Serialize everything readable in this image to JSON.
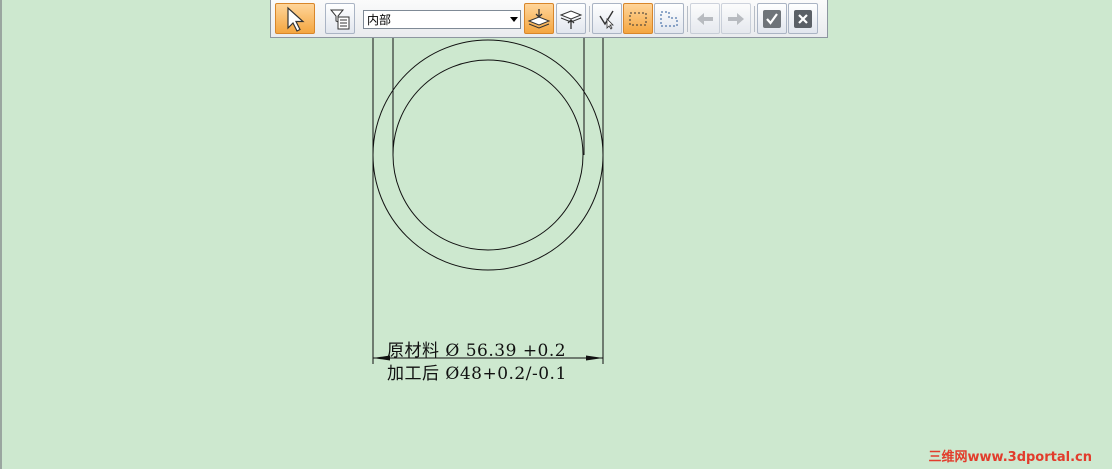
{
  "toolbar": {
    "select_value": "内部"
  },
  "drawing": {
    "dimension_line_1": "原材料 Ø 56.39 +0.2",
    "dimension_line_2": "加工后 Ø48+0.2/-0.1"
  },
  "watermark": "三维网www.3dportal.cn",
  "colors": {
    "canvas_background": "#cde8cf",
    "active_button": "#f4a640",
    "watermark": "#e23c2c"
  }
}
